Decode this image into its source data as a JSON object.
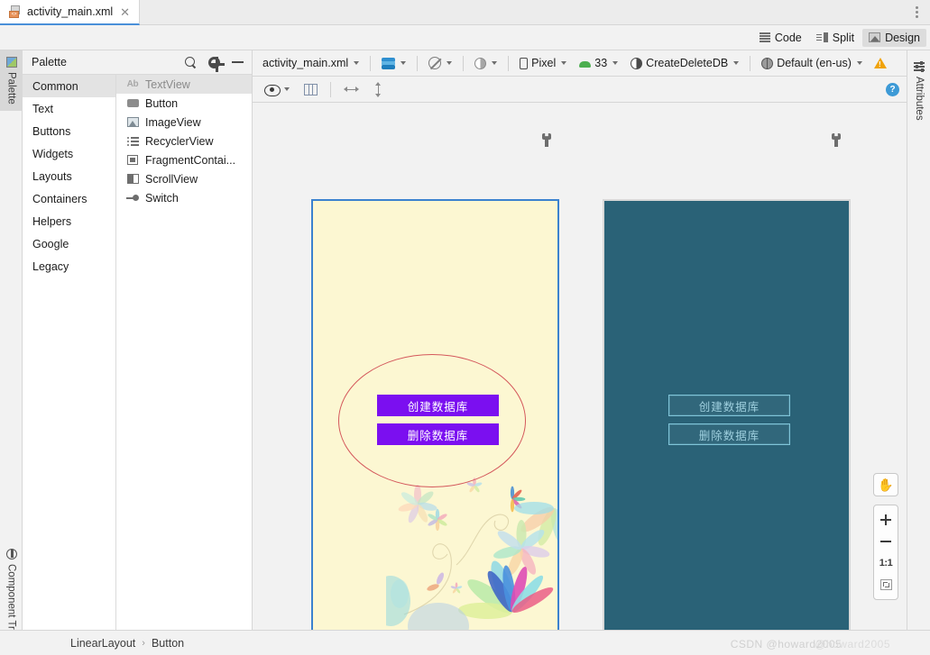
{
  "window": {
    "editor_tab": {
      "title": "activity_main.xml",
      "close": "✕",
      "icon": "xml-file-icon"
    },
    "kebab_menu": "more-options-icon"
  },
  "mode_switch": {
    "items": [
      {
        "label": "Code",
        "icon": "code-lines-icon",
        "active": false
      },
      {
        "label": "Split",
        "icon": "split-view-icon",
        "active": false
      },
      {
        "label": "Design",
        "icon": "design-view-icon",
        "active": true
      }
    ]
  },
  "left_strip": {
    "tabs": [
      {
        "label": "Palette",
        "icon": "palette-icon",
        "selected": true
      },
      {
        "label": "Component Tree",
        "icon": "component-tree-icon",
        "selected": false
      }
    ]
  },
  "right_strip": {
    "tabs": [
      {
        "label": "Attributes",
        "icon": "sliders-icon",
        "selected": false
      }
    ]
  },
  "palette": {
    "title": "Palette",
    "header_icons": [
      "search-icon",
      "gear-icon",
      "minimize-icon"
    ],
    "categories": [
      {
        "label": "Common",
        "selected": true
      },
      {
        "label": "Text",
        "selected": false
      },
      {
        "label": "Buttons",
        "selected": false
      },
      {
        "label": "Widgets",
        "selected": false
      },
      {
        "label": "Layouts",
        "selected": false
      },
      {
        "label": "Containers",
        "selected": false
      },
      {
        "label": "Helpers",
        "selected": false
      },
      {
        "label": "Google",
        "selected": false
      },
      {
        "label": "Legacy",
        "selected": false
      }
    ],
    "items": [
      {
        "label": "TextView",
        "icon": "textview-ab-icon",
        "selected": true,
        "badge": "Ab"
      },
      {
        "label": "Button",
        "icon": "button-icon",
        "selected": false
      },
      {
        "label": "ImageView",
        "icon": "imageview-icon",
        "selected": false
      },
      {
        "label": "RecyclerView",
        "icon": "recyclerview-icon",
        "selected": false
      },
      {
        "label": "FragmentContai...",
        "icon": "fragment-container-icon",
        "selected": false
      },
      {
        "label": "ScrollView",
        "icon": "scrollview-icon",
        "selected": false
      },
      {
        "label": "Switch",
        "icon": "switch-icon",
        "selected": false
      }
    ]
  },
  "design_toolbar": {
    "file_selector": "activity_main.xml",
    "layers_icon": "layers-icon",
    "orientation_icon": "no-rotation-icon",
    "theme_icon": "theme-halfcircle-icon",
    "device": "Pixel",
    "device_icon": "phone-icon",
    "api_level": "33",
    "api_icon": "android-icon",
    "theme": "CreateDeleteDB",
    "theme_selector_icon": "contrast-icon",
    "locale": "Default (en-us)",
    "locale_icon": "globe-icon",
    "warning_icon": "warning-triangle-icon"
  },
  "view_toolbar": {
    "view_mode_icon": "eye-icon",
    "columns_icon": "columns-layout-icon",
    "horizontal_icon": "horizontal-resize-icon",
    "vertical_icon": "vertical-resize-icon",
    "help_icon": "help-question-icon"
  },
  "canvas": {
    "render_wrench_icon": "wrench-icon",
    "blueprint_wrench_icon": "wrench-icon",
    "resize_handle": "diagonal-resize-handle",
    "render_preview": {
      "name": "design-render-preview",
      "background_color": "#fcf7d2",
      "selection_border_color": "#3b82cf",
      "ellipse_stroke_color": "#d4585c",
      "buttons": [
        {
          "label": "创建数据库",
          "bg": "#7b0ff0",
          "fg": "#ffffff"
        },
        {
          "label": "删除数据库",
          "bg": "#7b0ff0",
          "fg": "#ffffff"
        }
      ],
      "decoration": "pastel-flowers-graphic"
    },
    "blueprint_preview": {
      "name": "blueprint-preview",
      "background_color": "#2a6277",
      "outline_color": "#7fc4d8",
      "buttons": [
        {
          "label": "创建数据库"
        },
        {
          "label": "删除数据库"
        }
      ]
    }
  },
  "zoom_controls": {
    "pan_icon": "hand-pan-icon",
    "zoom_in": "+",
    "zoom_out": "−",
    "actual_size": "1:1",
    "zoom_to_fit_icon": "zoom-to-fit-icon"
  },
  "breadcrumb": {
    "items": [
      "LinearLayout",
      "Button"
    ],
    "separator": "›"
  },
  "watermark": {
    "text": "CSDN @howard2005",
    "overlap_text": "@howard2005"
  }
}
